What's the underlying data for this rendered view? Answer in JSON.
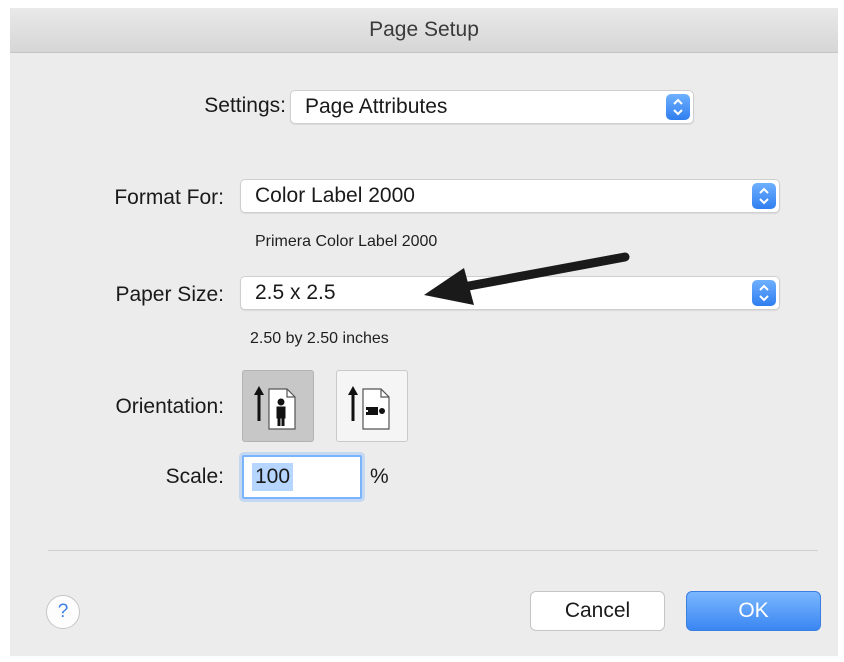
{
  "window": {
    "title": "Page Setup"
  },
  "settings": {
    "label": "Settings:",
    "value": "Page Attributes"
  },
  "format_for": {
    "label": "Format For:",
    "value": "Color Label 2000",
    "detail": "Primera Color Label 2000"
  },
  "paper_size": {
    "label": "Paper Size:",
    "value": "2.5 x 2.5",
    "detail": "2.50 by 2.50 inches"
  },
  "orientation": {
    "label": "Orientation:",
    "options": [
      "portrait",
      "landscape"
    ],
    "selected": "portrait"
  },
  "scale": {
    "label": "Scale:",
    "value": "100",
    "unit": "%"
  },
  "buttons": {
    "help": "?",
    "cancel": "Cancel",
    "ok": "OK"
  },
  "colors": {
    "accent": "#3a86f2",
    "selection": "#b7d6ff",
    "window_bg": "#ececec"
  },
  "icons": [
    "stepper-icon",
    "portrait-orientation-icon",
    "landscape-orientation-icon",
    "help-icon",
    "annotation-arrow"
  ]
}
